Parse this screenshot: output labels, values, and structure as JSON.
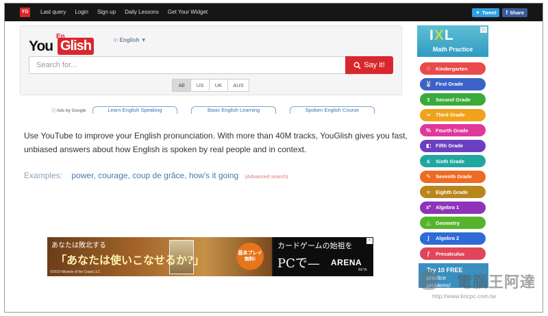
{
  "topbar": {
    "logo": "YG",
    "nav": [
      "Last query",
      "Login",
      "Sign up",
      "Daily Lessons",
      "Get Your Widget"
    ],
    "tweet_label": "Tweet",
    "share_label": "Share"
  },
  "search": {
    "brand_you": "You",
    "brand_en": "En",
    "brand_glish": "Glish",
    "lang_in": "in",
    "lang_value": "English",
    "lang_caret": "▼",
    "placeholder": "Search for...",
    "button_label": "Say it!",
    "accents": [
      "All",
      "US",
      "UK",
      "AUS"
    ],
    "active_accent": "All"
  },
  "ad_links": {
    "label": "ⓘ Ads by Google",
    "links": [
      "Learn English Speaking",
      "Basic English Learning",
      "Spoken English Course"
    ]
  },
  "description": "Use YouTube to improve your English pronunciation. With more than 40M tracks, YouGlish gives you fast, unbiased answers about how English is spoken by real people and in context.",
  "examples": {
    "label": "Examples:",
    "items": [
      "power",
      "courage",
      "coup de grâce",
      "how's it going"
    ],
    "advanced": "(Advanced search)"
  },
  "banner_ad": {
    "line1": "あなたは敗北する",
    "line2": "「あなたは使いこなせるか?」",
    "cta": "基本プレイ無料!",
    "copyright": "©2019 Wizards of the Coast LLC",
    "right_line1": "カードゲームの始祖を",
    "right_line2": "PCで—",
    "brand": "ARENA",
    "beta": "BETA",
    "close": "✕"
  },
  "side_ad": {
    "logo_i": "I",
    "logo_x": "X",
    "logo_l": "L",
    "subtitle": "Math Practice",
    "grades": [
      {
        "label": "Kindergarten",
        "icon": "⁘",
        "color": "#e94a4a"
      },
      {
        "label": "First Grade",
        "icon": "🐰",
        "color": "#3b62c9"
      },
      {
        "label": "Second Grade",
        "icon": "±",
        "color": "#3aaa3a"
      },
      {
        "label": "Third Grade",
        "icon": "∞",
        "color": "#f0a21a"
      },
      {
        "label": "Fourth Grade",
        "icon": "%",
        "color": "#e0389a"
      },
      {
        "label": "Fifth Grade",
        "icon": "◧",
        "color": "#6b3fc2"
      },
      {
        "label": "Sixth Grade",
        "icon": "≤",
        "color": "#1fa7a0"
      },
      {
        "label": "Seventh Grade",
        "icon": "✎",
        "color": "#ef6a22"
      },
      {
        "label": "Eighth Grade",
        "icon": "≈",
        "color": "#b9861e"
      },
      {
        "label": "Algebra 1",
        "icon": "x²",
        "color": "#8e34b8"
      },
      {
        "label": "Geometry",
        "icon": "△",
        "color": "#58b32c"
      },
      {
        "label": "Algebra 2",
        "icon": "∫",
        "color": "#2f6bd6"
      },
      {
        "label": "Precalculus",
        "icon": "ƒ",
        "color": "#e0455a"
      }
    ],
    "free_line1": "Try 10 FREE",
    "free_line2": "practice",
    "free_line3": "problems!"
  },
  "watermark": {
    "name": "電腦王阿達",
    "url": "http://www.kocpc.com.tw"
  },
  "colors": {
    "brand_red": "#d9272e",
    "topbar": "#161616"
  }
}
